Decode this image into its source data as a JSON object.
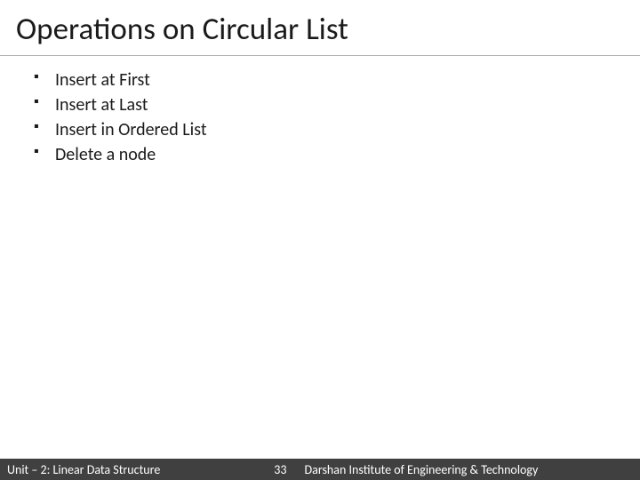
{
  "title": "Operations on Circular List",
  "bullets": {
    "item0": "Insert at First",
    "item1": "Insert at Last",
    "item2": "Insert in Ordered List",
    "item3": "Delete a node"
  },
  "footer": {
    "unit": "Unit – 2: Linear Data Structure",
    "page": "33",
    "institute": "Darshan Institute of Engineering & Technology"
  }
}
